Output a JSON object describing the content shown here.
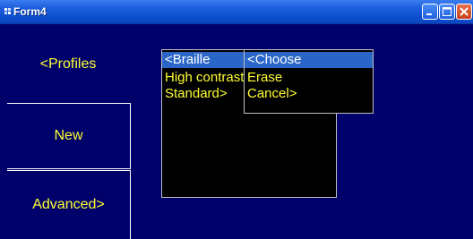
{
  "window": {
    "title": "Form4",
    "minimize_icon": "minimize-icon",
    "maximize_icon": "maximize-icon",
    "close_icon": "close-icon"
  },
  "sidebar": {
    "profiles_label": "<Profiles",
    "new_label": "New",
    "advanced_label": "Advanced>"
  },
  "profile_list": {
    "items": [
      {
        "label": "<Braille",
        "selected": true
      },
      {
        "label": "High contrast",
        "selected": false
      },
      {
        "label": "Standard>",
        "selected": false
      }
    ]
  },
  "context_menu": {
    "items": [
      {
        "label": "<Choose",
        "selected": true
      },
      {
        "label": "Erase",
        "selected": false
      },
      {
        "label": "Cancel>",
        "selected": false
      }
    ]
  },
  "colors": {
    "background": "#00006b",
    "text": "#ffff33",
    "selection": "#2a66c8",
    "title_bar": "#0d4fd0"
  }
}
